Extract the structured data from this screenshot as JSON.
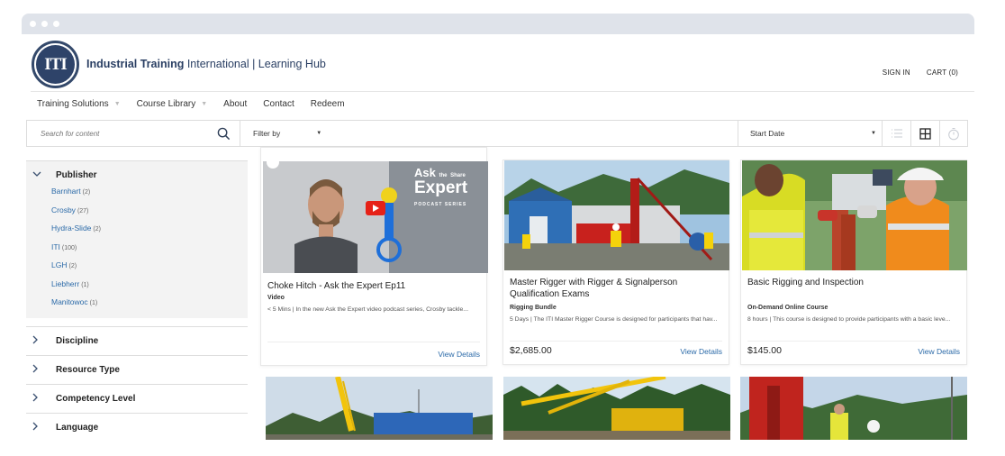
{
  "brand": {
    "logo_text": "ITI",
    "name_bold": "Industrial Training",
    "name_rest": " International | Learning Hub"
  },
  "top_links": {
    "sign_in": "SIGN IN",
    "cart": "CART (0)"
  },
  "nav": [
    {
      "label": "Training Solutions",
      "has_caret": true
    },
    {
      "label": "Course Library",
      "has_caret": true
    },
    {
      "label": "About",
      "has_caret": false
    },
    {
      "label": "Contact",
      "has_caret": false
    },
    {
      "label": "Redeem",
      "has_caret": false
    }
  ],
  "toolbar": {
    "search_placeholder": "Search for content",
    "filter_label": "Filter by",
    "sort_label": "Start Date"
  },
  "sidebar": {
    "publisher_heading": "Publisher",
    "publishers": [
      {
        "name": "Barnhart",
        "count": "(2)"
      },
      {
        "name": "Crosby",
        "count": "(27)"
      },
      {
        "name": "Hydra-Slide",
        "count": "(2)"
      },
      {
        "name": "ITI",
        "count": "(100)"
      },
      {
        "name": "LGH",
        "count": "(2)"
      },
      {
        "name": "Liebherr",
        "count": "(1)"
      },
      {
        "name": "Manitowoc",
        "count": "(1)"
      }
    ],
    "facets": [
      "Discipline",
      "Resource Type",
      "Competency Level",
      "Language"
    ]
  },
  "cards": [
    {
      "title": "Choke Hitch - Ask the Expert Ep11",
      "type": "Video",
      "desc": "< 5 Mins | In the new Ask the Expert video podcast series, Crosby tackle...",
      "price": "",
      "details": "View Details",
      "img_text_1": "Ask",
      "img_text_2": "the",
      "img_text_3": "Share",
      "img_text_4": "Expert",
      "img_text_5": "PODCAST SERIES"
    },
    {
      "title": "Master Rigger with Rigger & Signalperson Qualification Exams",
      "type": "Rigging Bundle",
      "desc": "5 Days | The ITI Master Rigger Course is designed for participants that hav...",
      "price": "$2,685.00",
      "details": "View Details"
    },
    {
      "title": "Basic Rigging and Inspection",
      "type": "On-Demand Online Course",
      "desc": "8 hours | This course is designed to provide participants with a basic leve...",
      "price": "$145.00",
      "details": "View Details"
    }
  ]
}
